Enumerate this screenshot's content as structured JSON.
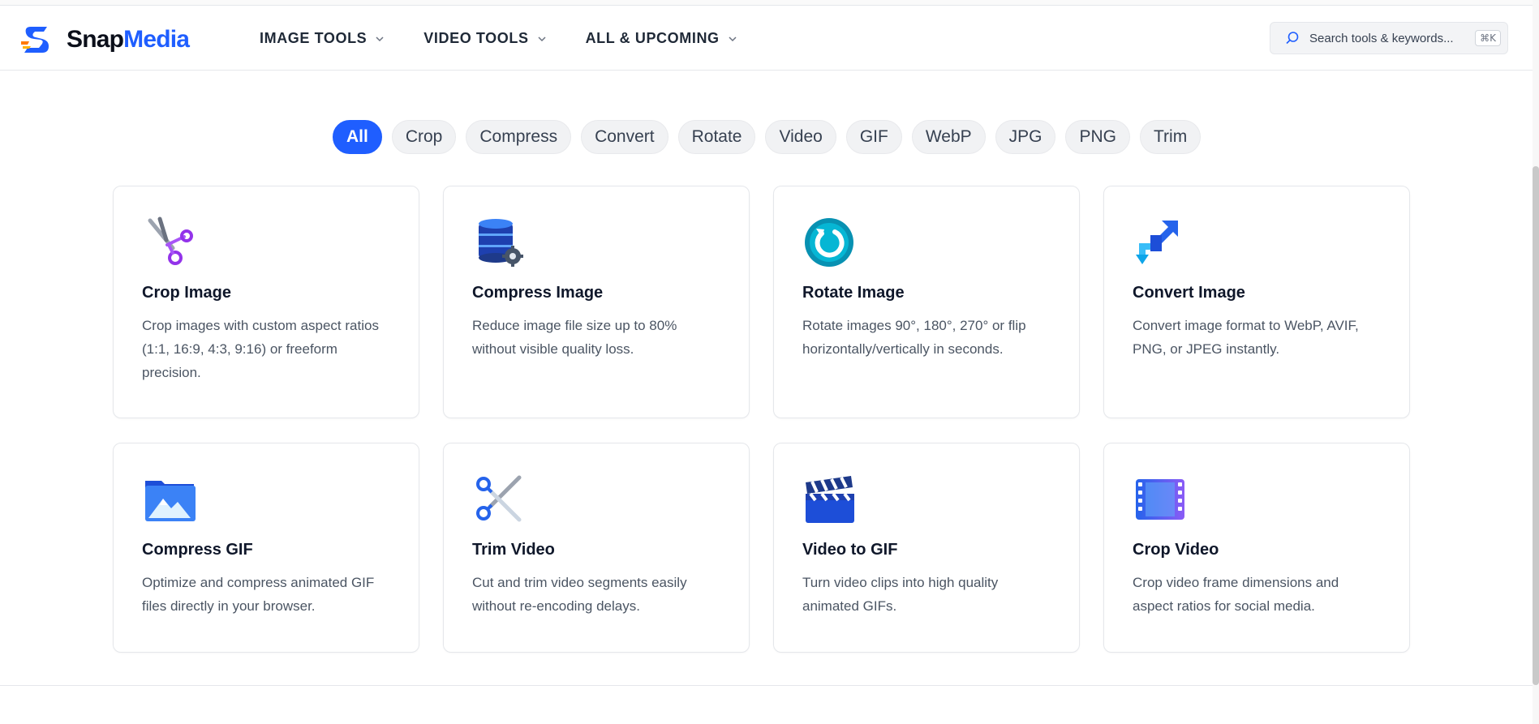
{
  "brand": {
    "part1": "Snap",
    "part2": "Media"
  },
  "nav": [
    {
      "label": "IMAGE TOOLS"
    },
    {
      "label": "VIDEO TOOLS"
    },
    {
      "label": "ALL & UPCOMING"
    }
  ],
  "search": {
    "placeholder": "Search tools & keywords...",
    "shortcut": "⌘K"
  },
  "filters": [
    "All",
    "Crop",
    "Compress",
    "Convert",
    "Rotate",
    "Video",
    "GIF",
    "WebP",
    "JPG",
    "PNG",
    "Trim"
  ],
  "active_filter": "All",
  "tools": [
    {
      "icon": "scissors-icon",
      "title": "Crop Image",
      "desc": "Crop images with custom aspect ratios (1:1, 16:9, 4:3, 9:16) or freeform precision."
    },
    {
      "icon": "database-gear-icon",
      "title": "Compress Image",
      "desc": "Reduce image file size up to 80% without visible quality loss."
    },
    {
      "icon": "rotate-icon",
      "title": "Rotate Image",
      "desc": "Rotate images 90°, 180°, 270° or flip horizontally/vertically in seconds."
    },
    {
      "icon": "convert-arrows-icon",
      "title": "Convert Image",
      "desc": "Convert image format to WebP, AVIF, PNG, or JPEG instantly."
    },
    {
      "icon": "image-folder-icon",
      "title": "Compress GIF",
      "desc": "Optimize and compress animated GIF files directly in your browser."
    },
    {
      "icon": "scissors-blue-icon",
      "title": "Trim Video",
      "desc": "Cut and trim video segments easily without re-encoding delays."
    },
    {
      "icon": "clapperboard-icon",
      "title": "Video to GIF",
      "desc": "Turn video clips into high quality animated GIFs."
    },
    {
      "icon": "film-strip-icon",
      "title": "Crop Video",
      "desc": "Crop video frame dimensions and aspect ratios for social media."
    }
  ],
  "colors": {
    "accent": "#1f5eff",
    "text": "#0f172a",
    "muted": "#4b5563",
    "chip_bg": "#f1f2f4"
  }
}
